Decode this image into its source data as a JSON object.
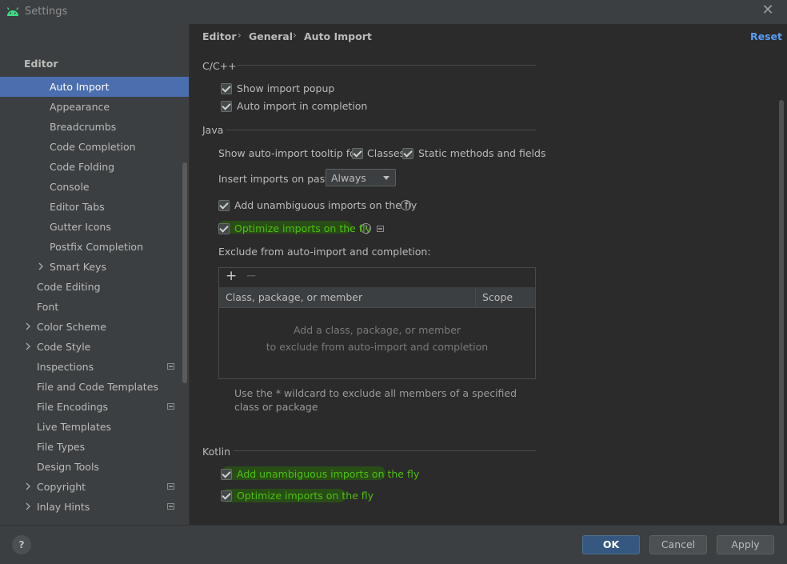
{
  "window": {
    "title": "Settings",
    "close_glyph": "✕"
  },
  "search": {
    "placeholder": ""
  },
  "sidebar": {
    "root_label": "Editor",
    "items": [
      {
        "label": "Auto Import",
        "selected": true
      },
      {
        "label": "Appearance"
      },
      {
        "label": "Breadcrumbs"
      },
      {
        "label": "Code Completion"
      },
      {
        "label": "Code Folding"
      },
      {
        "label": "Console"
      },
      {
        "label": "Editor Tabs"
      },
      {
        "label": "Gutter Icons"
      },
      {
        "label": "Postfix Completion"
      },
      {
        "label": "Smart Keys",
        "expandable": true
      },
      {
        "label": "Code Editing"
      },
      {
        "label": "Font"
      },
      {
        "label": "Color Scheme",
        "expandable": true
      },
      {
        "label": "Code Style",
        "expandable": true
      },
      {
        "label": "Inspections",
        "badge": true
      },
      {
        "label": "File and Code Templates"
      },
      {
        "label": "File Encodings",
        "badge": true
      },
      {
        "label": "Live Templates"
      },
      {
        "label": "File Types"
      },
      {
        "label": "Design Tools"
      },
      {
        "label": "Copyright",
        "expandable": true,
        "badge": true
      },
      {
        "label": "Inlay Hints",
        "expandable": true,
        "badge": true
      }
    ]
  },
  "breadcrumb": {
    "items": [
      "Editor",
      "General",
      "Auto Import"
    ],
    "separator": "›"
  },
  "reset_label": "Reset",
  "cpp": {
    "title": "C/C++",
    "show_import_popup": "Show import popup",
    "auto_import_completion": "Auto import in completion"
  },
  "java": {
    "title": "Java",
    "tooltip_label": "Show auto-import tooltip for:",
    "classes": "Classes",
    "static_methods": "Static methods and fields",
    "insert_on_paste_label": "Insert imports on paste:",
    "insert_on_paste_value": "Always",
    "add_unambiguous": "Add unambiguous imports on the fly",
    "optimize": "Optimize imports on the fly",
    "exclude_label": "Exclude from auto-import and completion:",
    "table": {
      "add": "+",
      "remove": "−",
      "col_class": "Class, package, or member",
      "col_scope": "Scope",
      "empty_line1": "Add a class, package, or member",
      "empty_line2": "to exclude from auto-import and completion"
    },
    "hint": "Use the * wildcard to exclude all members of a specified class or package"
  },
  "kotlin": {
    "title": "Kotlin",
    "add_unambiguous": "Add unambiguous imports on the fly",
    "optimize": "Optimize imports on the fly"
  },
  "footer": {
    "help": "?",
    "ok": "OK",
    "cancel": "Cancel",
    "apply": "Apply"
  },
  "colors": {
    "accent": "#4b6eaf",
    "link": "#589df6",
    "highlight": "#4ec00e"
  }
}
